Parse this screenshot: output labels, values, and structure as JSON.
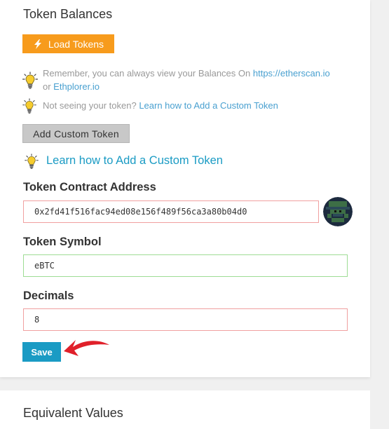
{
  "balances": {
    "title": "Token Balances",
    "load_label": "Load Tokens",
    "tip1_text": "Remember, you can always view your Balances On ",
    "tip1_link1": "https://etherscan.io",
    "tip1_or": "or ",
    "tip1_link2": "Ethplorer.io",
    "tip2_text": "Not seeing your token? ",
    "tip2_link": "Learn how to Add a Custom Token",
    "add_custom_label": "Add Custom Token",
    "learn_link": "Learn how to Add a Custom Token"
  },
  "form": {
    "address_label": "Token Contract Address",
    "address_value": "0x2fd41f516fac94ed08e156f489f56ca3a80b04d0",
    "symbol_label": "Token Symbol",
    "symbol_value": "eBTC",
    "decimals_label": "Decimals",
    "decimals_value": "8",
    "save_label": "Save"
  },
  "equivalent": {
    "title": "Equivalent Values"
  },
  "colors": {
    "load_button": "#f79b1c",
    "save_button": "#1a9bc4",
    "link": "#49a0d0",
    "error_border": "#f0a0a0",
    "valid_border": "#9edc94",
    "arrow": "#e0202a"
  },
  "icons": {
    "load": "lightning-bolt-icon",
    "tip": "lightbulb-icon",
    "identicon": "address-identicon",
    "pointer": "red-arrow-icon"
  }
}
